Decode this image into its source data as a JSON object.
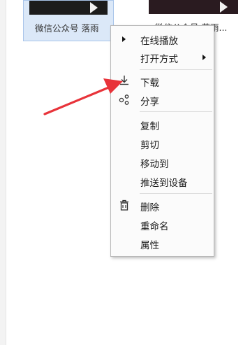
{
  "files": [
    {
      "name": "微信公众号 落雨"
    },
    {
      "name": "微信公众号 落雨..."
    }
  ],
  "context_menu": {
    "items": [
      {
        "label": "在线播放",
        "icon": "play-arrow-icon"
      },
      {
        "label": "打开方式",
        "icon": "submenu-arrow-icon"
      },
      {
        "label": "下载",
        "icon": "download-icon"
      },
      {
        "label": "分享",
        "icon": "share-icon"
      },
      {
        "label": "复制"
      },
      {
        "label": "剪切"
      },
      {
        "label": "移动到"
      },
      {
        "label": "推送到设备"
      },
      {
        "label": "删除",
        "icon": "trash-icon"
      },
      {
        "label": "重命名"
      },
      {
        "label": "属性"
      }
    ]
  },
  "colors": {
    "annotation": "#e8333a",
    "selection": "#dbe8f8"
  }
}
